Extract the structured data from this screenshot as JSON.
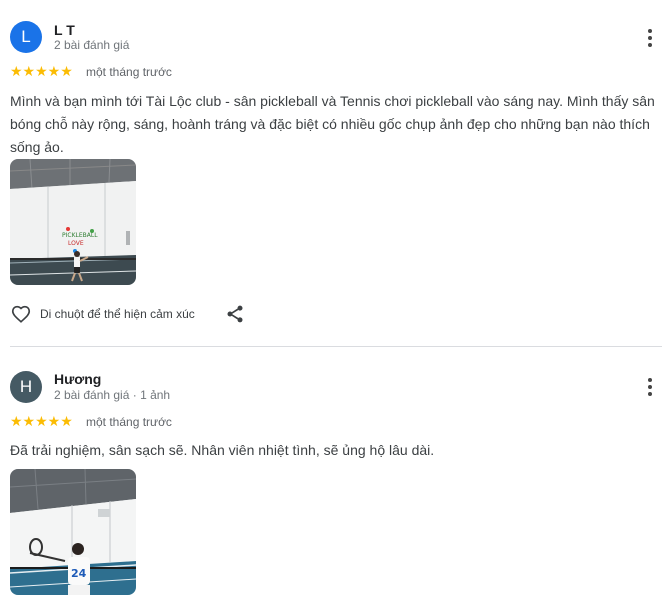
{
  "reviews": [
    {
      "avatar_letter": "L",
      "avatar_color": "#1a73e8",
      "name": "L T",
      "meta": "2 bài đánh giá",
      "stars": "★★★★★",
      "time": "một tháng trước",
      "text": "Mình và bạn mình tới Tài Lộc club - sân pickleball và Tennis chơi pickleball vào sáng nay. Mình thấy sân bóng chỗ này rộng, sáng, hoành tráng và đặc biệt có nhiều gốc chụp ảnh đẹp cho những bạn nào thích sống ảo.",
      "reaction_label": "Di chuột để thể hiện cảm xúc",
      "photo_icon": "pickleball-court-photo"
    },
    {
      "avatar_letter": "H",
      "avatar_color": "#455a64",
      "name": "Hương",
      "meta": "2 bài đánh giá · 1 ảnh",
      "stars": "★★★★★",
      "time": "một tháng trước",
      "text": "Đã trải nghiệm, sân sạch sẽ. Nhân viên nhiệt tình, sẽ ủng hộ lâu dài.",
      "photo_icon": "player-on-court-photo",
      "jersey_number": "24"
    }
  ],
  "accent": {
    "star": "#fbbc04",
    "divider": "#dadce0"
  }
}
